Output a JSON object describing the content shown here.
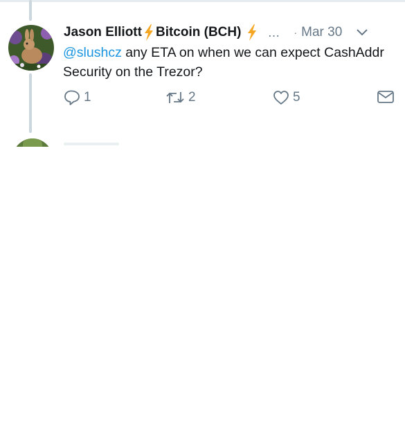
{
  "tweet": {
    "display_name": "Jason Elliott",
    "name_emoji_icon": "high-voltage-icon",
    "name_suffix": "Bitcoin (BCH)",
    "ellipsis": "…",
    "separator": "·",
    "date": "Mar 30",
    "mention": "@slushcz",
    "text": " any ETA on when we can expect CashAddr Security on the Trezor?",
    "reply_count": "1",
    "retweet_count": "2",
    "like_count": "5"
  },
  "colors": {
    "link": "#1b95e0",
    "muted": "#657786",
    "thread_line": "#ccd6dd",
    "bolt": "#f5a623"
  }
}
